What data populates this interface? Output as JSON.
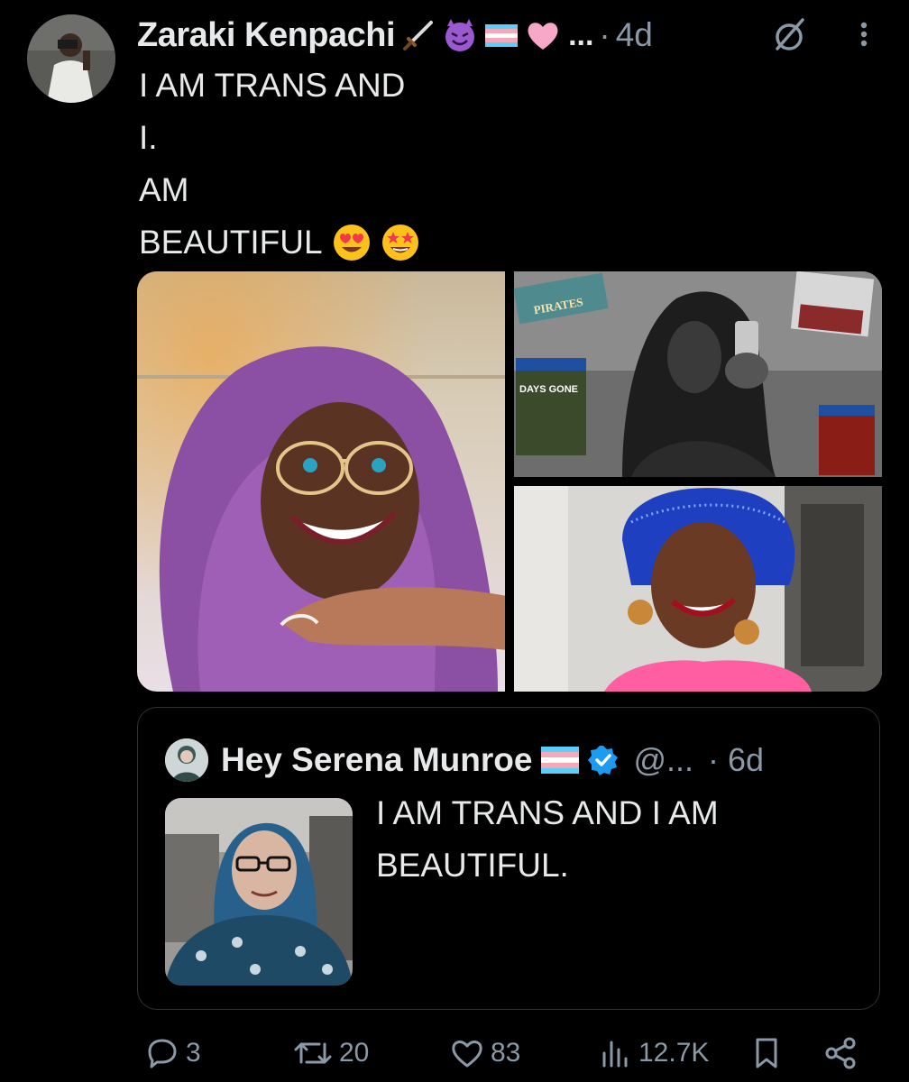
{
  "tweet": {
    "author_name": "Zaraki Kenpachi",
    "author_emoji_suffix": "...",
    "time": "4d",
    "dot": "·",
    "lines": [
      "I AM TRANS AND",
      "I.",
      "AM",
      "BEAUTIFUL"
    ]
  },
  "quote": {
    "author_name": "Hey Serena Munroe",
    "handle": "@...",
    "dot": "·",
    "time": "6d",
    "text": "I AM TRANS AND I AM BEAUTIFUL."
  },
  "actions": {
    "replies": "3",
    "reposts": "20",
    "likes": "83",
    "views": "12.7K"
  },
  "icons": [
    "sword-emoji",
    "smiling-devil-emoji",
    "trans-flag-emoji",
    "pink-heart-emoji",
    "heart-eyes-emoji",
    "star-struck-emoji",
    "grok-icon",
    "more-icon",
    "verified-badge-icon",
    "reply-icon",
    "repost-icon",
    "like-icon",
    "views-icon",
    "bookmark-icon",
    "share-icon"
  ],
  "colors": {
    "background": "#000000",
    "text": "#e7e9ea",
    "muted": "#8b98a5",
    "border": "#2f3336",
    "verified": "#1d9bf0"
  }
}
